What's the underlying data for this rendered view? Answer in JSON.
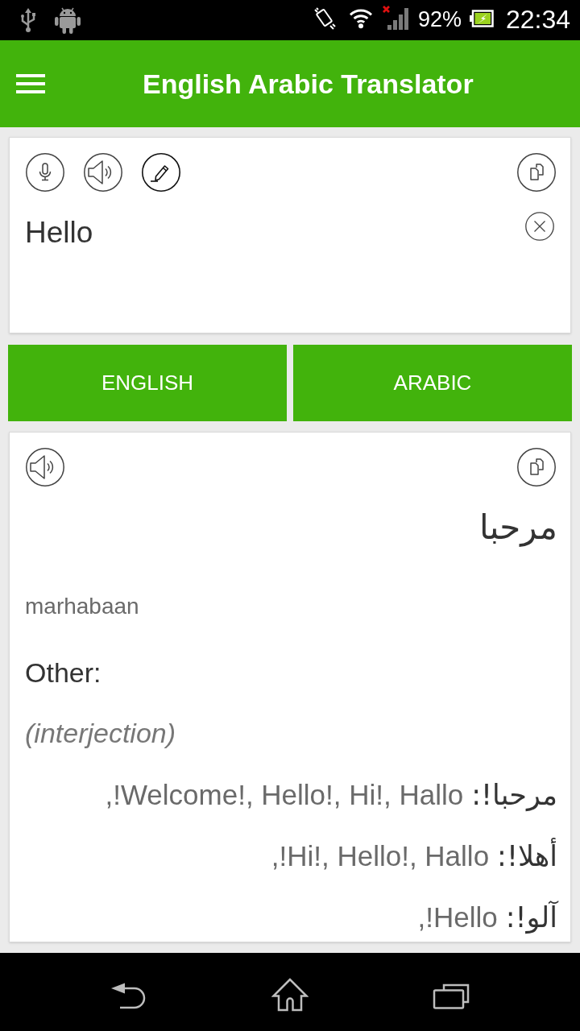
{
  "status_bar": {
    "battery": "92%",
    "time": "22:34"
  },
  "app_bar": {
    "title": "English Arabic Translator"
  },
  "input": {
    "value": "Hello"
  },
  "language_buttons": [
    {
      "label": "ENGLISH"
    },
    {
      "label": "ARABIC"
    }
  ],
  "result": {
    "translation": "مرحبا",
    "transliteration": "marhabaan",
    "other_heading": "Other:",
    "part_of_speech": "(interjection)",
    "entries": [
      {
        "term": "مرحبا!:",
        "translations": "Welcome!, Hello!, Hi!, Hallo!,"
      },
      {
        "term": "أهلا!:",
        "translations": "Hi!, Hello!, Hallo!,"
      },
      {
        "term": "آلو!:",
        "translations": "Hello!,"
      }
    ]
  }
}
